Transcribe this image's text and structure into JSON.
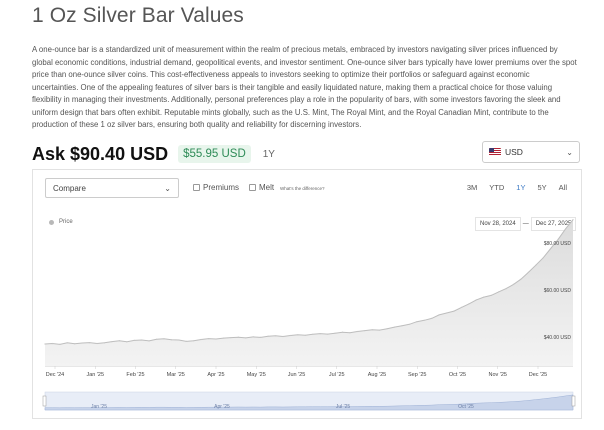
{
  "page": {
    "title": "1 Oz Silver Bar Values",
    "description": "A one-ounce bar is a standardized unit of measurement within the realm of precious metals, embraced by investors navigating silver prices influenced by global economic conditions, industrial demand, geopolitical events, and investor sentiment. One-ounce silver bars typically have lower premiums over the spot price than one-ounce silver coins. This cost-effectiveness appeals to investors seeking to optimize their portfolios or safeguard against economic uncertainties. One of the appealing features of silver bars is their tangible and easily liquidated nature, making them a practical choice for those valuing flexibility in managing their investments. Additionally, personal preferences play a role in the popularity of bars, with some investors favoring the sleek and uniform design that bars often exhibit. Reputable mints globally, such as the U.S. Mint, The Royal Mint, and the Royal Canadian Mint, contribute to the production of these 1 oz silver bars, ensuring both quality and reliability for discerning investors."
  },
  "price": {
    "ask": "Ask $90.40 USD",
    "change": "$55.95 USD",
    "period": "1Y"
  },
  "currency": {
    "selected": "USD",
    "icon": "us-flag-icon"
  },
  "controls": {
    "compare": "Compare",
    "premiums": "Premiums",
    "melt": "Melt",
    "difference_link": "What's the difference?",
    "periods": [
      "3M",
      "YTD",
      "1Y",
      "5Y",
      "All"
    ],
    "active_period": "1Y"
  },
  "legend": {
    "series": "Price",
    "from": "Nov 28, 2024",
    "to": "Dec 27, 2025",
    "separator": "—"
  },
  "colors": {
    "accent": "#3a78c4",
    "change_green": "#2e8b57",
    "area_fill": "#e8e8e8",
    "line": "#bdbdbd"
  },
  "chart_data": {
    "type": "area",
    "series": [
      {
        "name": "Price",
        "values": [
          37.4,
          37.6,
          37.2,
          37.9,
          37.5,
          37.8,
          38.0,
          37.6,
          37.9,
          38.4,
          38.8,
          38.3,
          38.9,
          39.1,
          38.7,
          39.4,
          39.6,
          39.2,
          39.1,
          38.5,
          38.8,
          39.3,
          39.7,
          39.5,
          39.9,
          40.1,
          40.3,
          40.0,
          40.4,
          40.2,
          40.7,
          40.9,
          40.6,
          41.0,
          41.3,
          41.1,
          41.5,
          41.8,
          41.6,
          42.0,
          42.4,
          42.2,
          42.7,
          43.1,
          43.5,
          43.3,
          43.9,
          44.6,
          45.2,
          45.8,
          46.9,
          47.5,
          48.3,
          49.8,
          50.6,
          51.4,
          53.0,
          54.5,
          56.2,
          57.4,
          58.1,
          59.6,
          61.0,
          62.8,
          65.0,
          67.9,
          71.0,
          74.2,
          78.1,
          82.0,
          86.5,
          90.4
        ]
      }
    ],
    "x_labels": [
      "Dec '24",
      "Jan '25",
      "Feb '25",
      "Mar '25",
      "Apr '25",
      "May '25",
      "Jun '25",
      "Jul '25",
      "Aug '25",
      "Sep '25",
      "Oct '25",
      "Nov '25",
      "Dec '25"
    ],
    "y_ticks": [
      "$40.00 USD",
      "$60.00 USD",
      "$80.00 USD"
    ],
    "y_tick_values": [
      40,
      60,
      80
    ],
    "ylim": [
      28,
      86
    ],
    "navigator_labels": [
      "Jan '25",
      "Apr '25",
      "Jul '25",
      "Oct '25"
    ],
    "legend_position": "top-left",
    "grid": false
  }
}
